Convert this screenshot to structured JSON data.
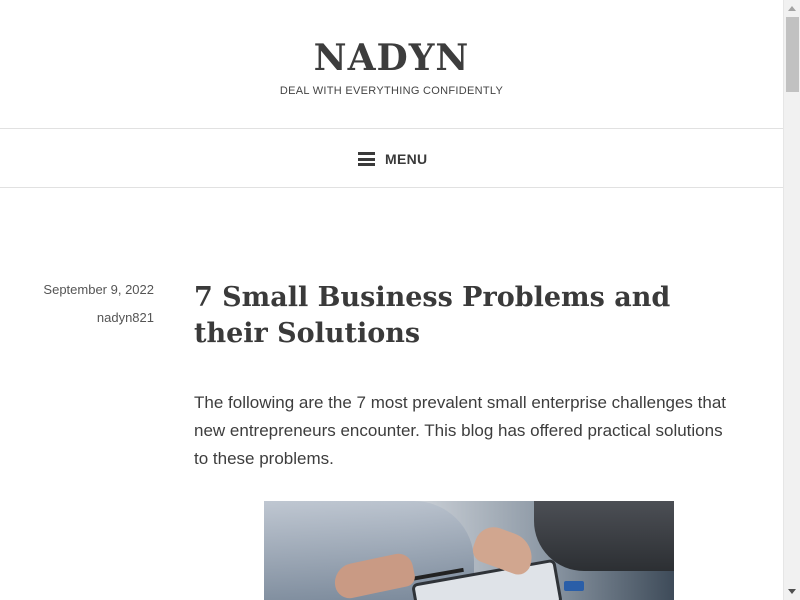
{
  "header": {
    "site_title": "NADYN",
    "tagline": "DEAL WITH EVERYTHING CONFIDENTLY"
  },
  "nav": {
    "menu_label": "MENU",
    "menu_icon": "hamburger-icon"
  },
  "post": {
    "date": "September 9, 2022",
    "author": "nadyn821",
    "title": "7 Small Business Problems and their Solutions",
    "intro": "The following are the 7 most prevalent small enterprise challenges that new entrepreneurs encounter. This blog has offered practical solutions to these problems."
  },
  "scrollbar": {
    "up_icon": "scroll-up-arrow-icon",
    "down_icon": "scroll-down-arrow-icon"
  },
  "colors": {
    "text": "#3a3a3a",
    "border": "#e1e1e1",
    "background": "#ffffff"
  }
}
